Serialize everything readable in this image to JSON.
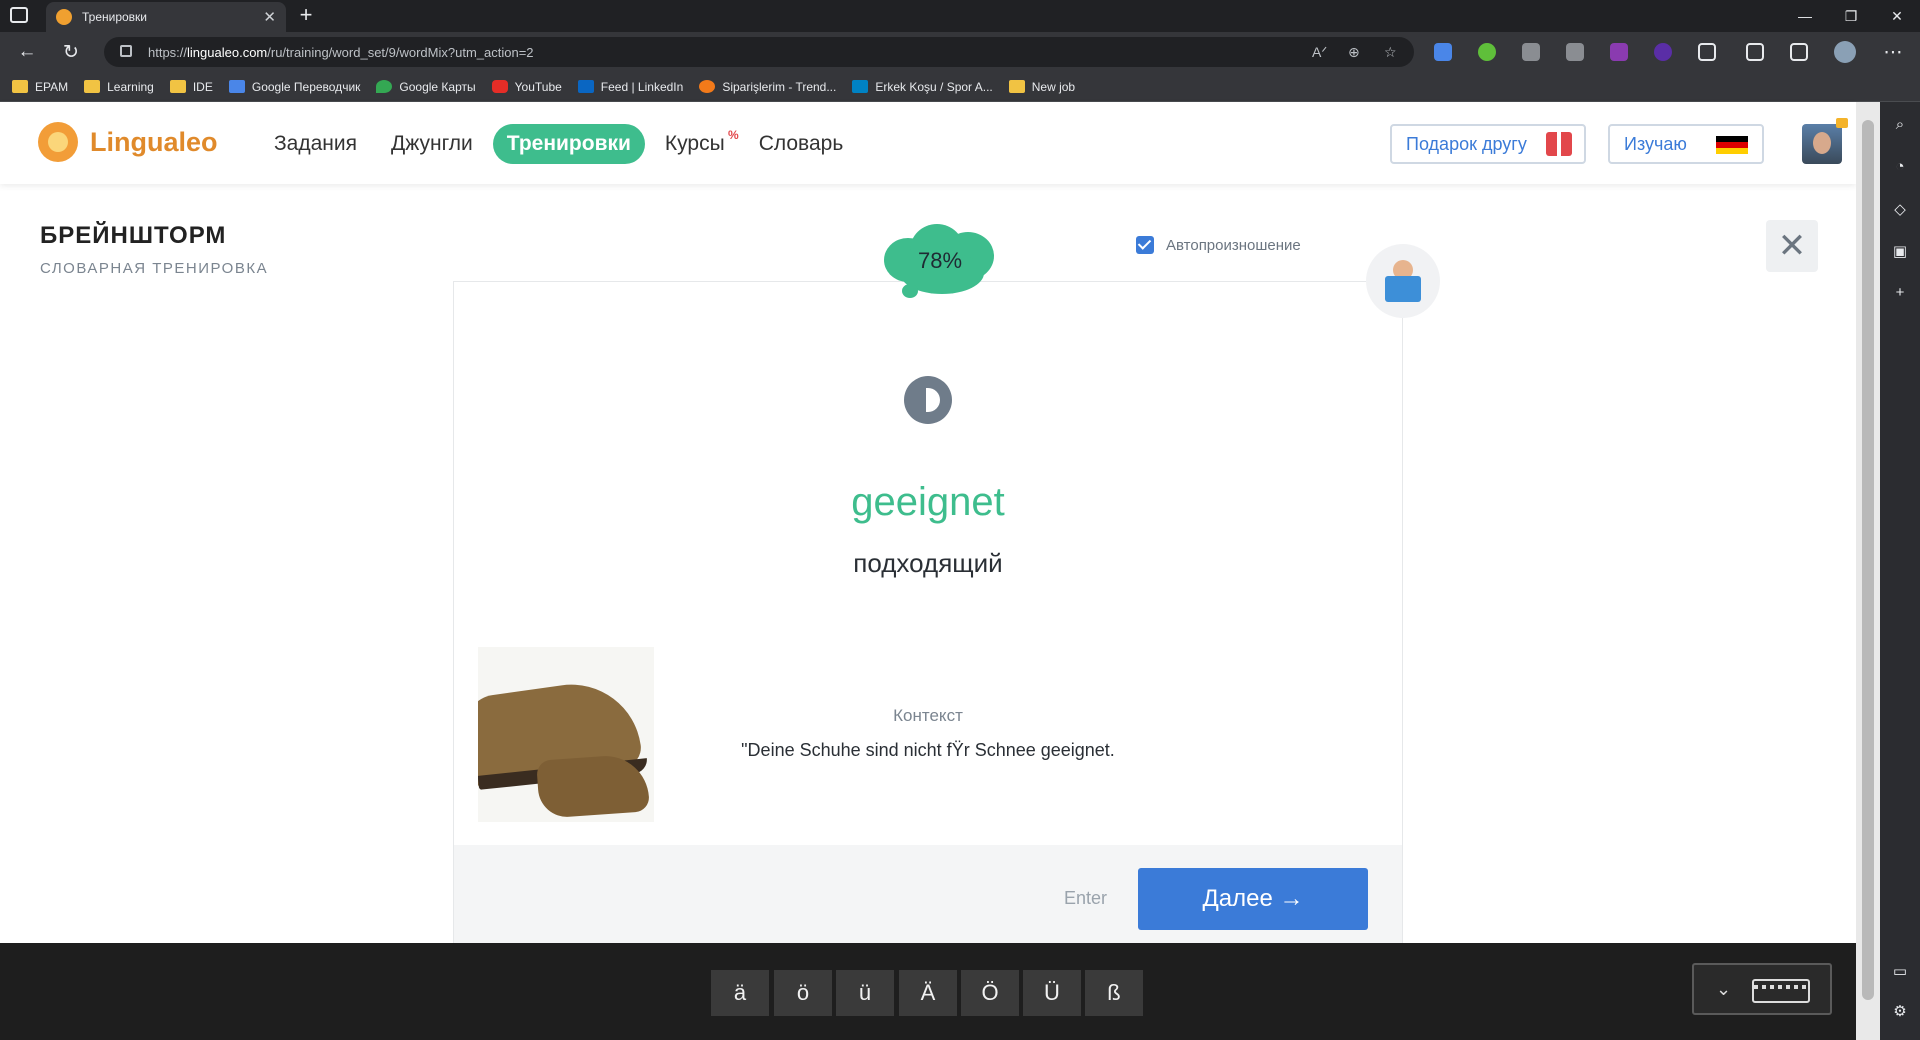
{
  "browser": {
    "tab_title": "Тренировки",
    "tab_close": "✕",
    "new_tab": "+",
    "url_prefix": "https://",
    "url_host": "lingualeo.com",
    "url_path": "/ru/training/word_set/9/wordMix?utm_action=2",
    "window_controls": [
      "—",
      "❐",
      "✕"
    ]
  },
  "bookmarks": [
    {
      "label": "EPAM",
      "icon": "folder-icon"
    },
    {
      "label": "Learning",
      "icon": "folder-icon"
    },
    {
      "label": "IDE",
      "icon": "folder-icon"
    },
    {
      "label": "Google Переводчик",
      "icon": "google-translate-icon"
    },
    {
      "label": "Google Карты",
      "icon": "google-maps-icon"
    },
    {
      "label": "YouTube",
      "icon": "youtube-icon"
    },
    {
      "label": "Feed | LinkedIn",
      "icon": "linkedin-icon"
    },
    {
      "label": "Siparişlerim - Trend...",
      "icon": "trendyol-icon"
    },
    {
      "label": "Erkek Koşu / Spor A...",
      "icon": "decathlon-icon"
    },
    {
      "label": "New job",
      "icon": "folder-icon"
    }
  ],
  "site": {
    "logo": "Lingualeo",
    "nav": [
      {
        "label": "Задания",
        "active": false
      },
      {
        "label": "Джунгли",
        "active": false
      },
      {
        "label": "Тренировки",
        "active": true
      },
      {
        "label": "Курсы",
        "active": false,
        "badge": "%"
      },
      {
        "label": "Словарь",
        "active": false
      }
    ],
    "gift_button": "Подарок другу",
    "learning_button": "Изучаю",
    "learning_flag": "germany-flag-icon"
  },
  "training": {
    "title": "БРЕЙНШТОРМ",
    "subtitle": "СЛОВАРНАЯ ТРЕНИРОВКА",
    "autopronounce_label": "Автопроизношение",
    "autopronounce_checked": true,
    "progress": "78%",
    "word": "geeignet",
    "translation": "подходящий",
    "context_label": "Контекст",
    "context_text": "\"Deine Schuhe sind nicht fŸr Schnee geeignet.",
    "enter_hint": "Enter",
    "next_button": "Далее →",
    "close_symbol": "✕"
  },
  "keyboard": {
    "keys": [
      "ä",
      "ö",
      "ü",
      "Ä",
      "Ö",
      "Ü",
      "ß"
    ]
  },
  "colors": {
    "accent_green": "#3ebd8d",
    "accent_blue": "#3b7bd8",
    "logo_orange": "#e08a2b"
  }
}
